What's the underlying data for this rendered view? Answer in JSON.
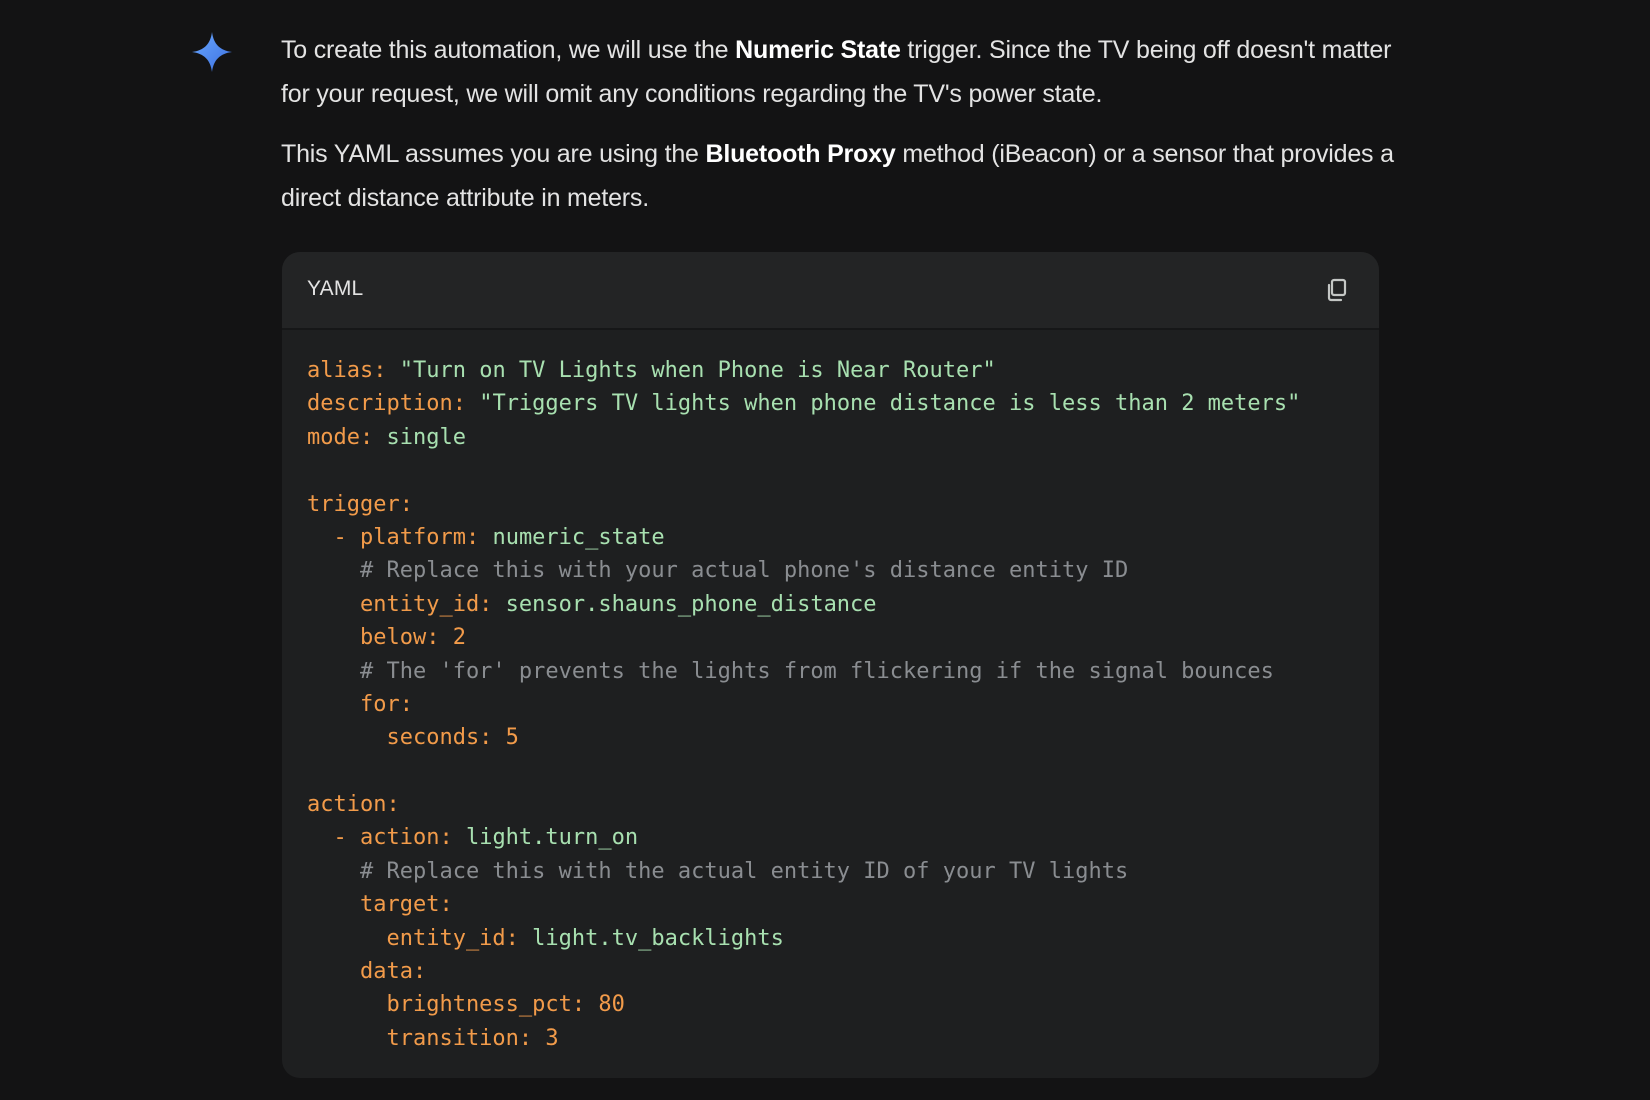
{
  "message": {
    "para1": [
      {
        "text": "To create this automation, we will use the ",
        "bold": false
      },
      {
        "text": "Numeric State",
        "bold": true
      },
      {
        "text": " trigger. Since the TV being off doesn't matter for your request, we will omit any conditions regarding the TV's power state.",
        "bold": false
      }
    ],
    "para2": [
      {
        "text": "This YAML assumes you are using the ",
        "bold": false
      },
      {
        "text": "Bluetooth Proxy",
        "bold": true
      },
      {
        "text": " method (iBeacon) or a sensor that provides a direct distance attribute in meters.",
        "bold": false
      }
    ]
  },
  "code_block": {
    "language": "YAML",
    "copy_icon": "copy-icon",
    "lines": [
      [
        {
          "t": "alias:",
          "c": "key"
        },
        {
          "t": " \"Turn on TV Lights when Phone is Near Router\"",
          "c": "str"
        }
      ],
      [
        {
          "t": "description:",
          "c": "key"
        },
        {
          "t": " \"Triggers TV lights when phone distance is less than 2 meters\"",
          "c": "str"
        }
      ],
      [
        {
          "t": "mode:",
          "c": "key"
        },
        {
          "t": " single",
          "c": "val"
        }
      ],
      [],
      [
        {
          "t": "trigger:",
          "c": "key"
        }
      ],
      [
        {
          "t": "  - ",
          "c": "dash"
        },
        {
          "t": "platform:",
          "c": "key"
        },
        {
          "t": " numeric_state",
          "c": "val"
        }
      ],
      [
        {
          "t": "    # Replace this with your actual phone's distance entity ID",
          "c": "com"
        }
      ],
      [
        {
          "t": "    entity_id:",
          "c": "key"
        },
        {
          "t": " sensor.shauns_phone_distance",
          "c": "val"
        }
      ],
      [
        {
          "t": "    below:",
          "c": "key"
        },
        {
          "t": " 2",
          "c": "num"
        }
      ],
      [
        {
          "t": "    # The 'for' prevents the lights from flickering if the signal bounces",
          "c": "com"
        }
      ],
      [
        {
          "t": "    for:",
          "c": "key"
        }
      ],
      [
        {
          "t": "      seconds:",
          "c": "key"
        },
        {
          "t": " 5",
          "c": "num"
        }
      ],
      [],
      [
        {
          "t": "action:",
          "c": "key"
        }
      ],
      [
        {
          "t": "  - ",
          "c": "dash"
        },
        {
          "t": "action:",
          "c": "key"
        },
        {
          "t": " light.turn_on",
          "c": "val"
        }
      ],
      [
        {
          "t": "    # Replace this with the actual entity ID of your TV lights",
          "c": "com"
        }
      ],
      [
        {
          "t": "    target:",
          "c": "key"
        }
      ],
      [
        {
          "t": "      entity_id:",
          "c": "key"
        },
        {
          "t": " light.tv_backlights",
          "c": "val"
        }
      ],
      [
        {
          "t": "    data:",
          "c": "key"
        }
      ],
      [
        {
          "t": "      brightness_pct:",
          "c": "key"
        },
        {
          "t": " 80",
          "c": "num"
        }
      ],
      [
        {
          "t": "      transition:",
          "c": "key"
        },
        {
          "t": " 3",
          "c": "num"
        }
      ]
    ]
  },
  "colors": {
    "background": "#131314",
    "code_background": "#1e1f20",
    "key": "#f29b4a",
    "string": "#a8e0b0",
    "comment": "#8a8d91",
    "spark_blue": "#4a8af4"
  },
  "icons": {
    "assistant": "gemini-spark-icon",
    "copy": "copy-icon"
  }
}
